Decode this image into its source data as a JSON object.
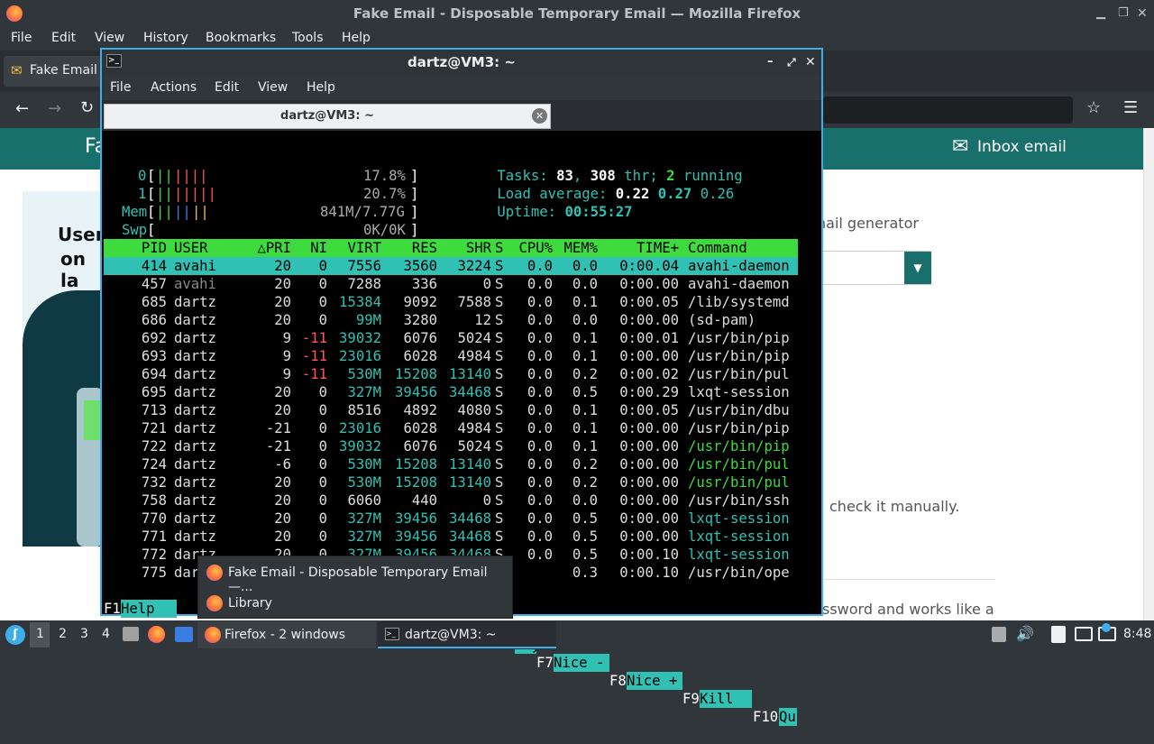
{
  "firefox": {
    "title": "Fake Email - Disposable Temporary Email — Mozilla Firefox",
    "menu": [
      "File",
      "Edit",
      "View",
      "History",
      "Bookmarks",
      "Tools",
      "Help"
    ],
    "tab_label": "Fake Email",
    "page": {
      "inbox_label": "Inbox email",
      "promo_title_1": "User",
      "promo_title_2": "on la",
      "header_left_fragment": "Fa",
      "generator_text": "nail generator",
      "check_text": "check it manually.",
      "password_text": "ssword and works like a"
    }
  },
  "terminal": {
    "title": "dartz@VM3: ~",
    "menu": [
      "File",
      "Actions",
      "Edit",
      "View",
      "Help"
    ],
    "tab_label": "dartz@VM3: ~",
    "htop": {
      "cpu0_label": "0",
      "cpu0_pct": "17.8%",
      "cpu1_label": "1",
      "cpu1_pct": "20.7%",
      "mem_label": "Mem",
      "mem_value": "841M/7.77G",
      "swp_label": "Swp",
      "swp_value": "0K/0K",
      "tasks_label": "Tasks:",
      "tasks_count": "83",
      "thr_count": "308",
      "thr_label": "thr;",
      "running_count": "2",
      "running_label": "running",
      "load_label": "Load average:",
      "load1": "0.22",
      "load5": "0.27",
      "load15": "0.26",
      "uptime_label": "Uptime:",
      "uptime": "00:55:27",
      "columns": [
        "PID",
        "USER",
        "△PRI",
        "NI",
        "VIRT",
        "RES",
        "SHR",
        "S",
        "CPU%",
        "MEM%",
        "TIME+",
        "Command"
      ],
      "rows": [
        [
          "414",
          "avahi",
          "20",
          "0",
          "7556",
          "3560",
          "3224",
          "S",
          "0.0",
          "0.0",
          "0:00.04",
          "avahi-daemon"
        ],
        [
          "457",
          "avahi",
          "20",
          "0",
          "7288",
          "336",
          "0",
          "S",
          "0.0",
          "0.0",
          "0:00.00",
          "avahi-daemon"
        ],
        [
          "685",
          "dartz",
          "20",
          "0",
          "15384",
          "9092",
          "7588",
          "S",
          "0.0",
          "0.1",
          "0:00.05",
          "/lib/systemd"
        ],
        [
          "686",
          "dartz",
          "20",
          "0",
          "99M",
          "3280",
          "12",
          "S",
          "0.0",
          "0.0",
          "0:00.00",
          "(sd-pam)"
        ],
        [
          "692",
          "dartz",
          "9",
          "-11",
          "39032",
          "6076",
          "5024",
          "S",
          "0.0",
          "0.1",
          "0:00.01",
          "/usr/bin/pip"
        ],
        [
          "693",
          "dartz",
          "9",
          "-11",
          "23016",
          "6028",
          "4984",
          "S",
          "0.0",
          "0.1",
          "0:00.00",
          "/usr/bin/pip"
        ],
        [
          "694",
          "dartz",
          "9",
          "-11",
          "530M",
          "15208",
          "13140",
          "S",
          "0.0",
          "0.2",
          "0:00.02",
          "/usr/bin/pul"
        ],
        [
          "695",
          "dartz",
          "20",
          "0",
          "327M",
          "39456",
          "34468",
          "S",
          "0.0",
          "0.5",
          "0:00.29",
          "lxqt-session"
        ],
        [
          "713",
          "dartz",
          "20",
          "0",
          "8516",
          "4892",
          "4080",
          "S",
          "0.0",
          "0.1",
          "0:00.05",
          "/usr/bin/dbu"
        ],
        [
          "721",
          "dartz",
          "-21",
          "0",
          "23016",
          "6028",
          "4984",
          "S",
          "0.0",
          "0.1",
          "0:00.00",
          "/usr/bin/pip"
        ],
        [
          "722",
          "dartz",
          "-21",
          "0",
          "39032",
          "6076",
          "5024",
          "S",
          "0.0",
          "0.1",
          "0:00.00",
          "/usr/bin/pip"
        ],
        [
          "724",
          "dartz",
          "-6",
          "0",
          "530M",
          "15208",
          "13140",
          "S",
          "0.0",
          "0.2",
          "0:00.00",
          "/usr/bin/pul"
        ],
        [
          "732",
          "dartz",
          "20",
          "0",
          "530M",
          "15208",
          "13140",
          "S",
          "0.0",
          "0.2",
          "0:00.00",
          "/usr/bin/pul"
        ],
        [
          "758",
          "dartz",
          "20",
          "0",
          "6060",
          "440",
          "0",
          "S",
          "0.0",
          "0.0",
          "0:00.00",
          "/usr/bin/ssh"
        ],
        [
          "770",
          "dartz",
          "20",
          "0",
          "327M",
          "39456",
          "34468",
          "S",
          "0.0",
          "0.5",
          "0:00.00",
          "lxqt-session"
        ],
        [
          "771",
          "dartz",
          "20",
          "0",
          "327M",
          "39456",
          "34468",
          "S",
          "0.0",
          "0.5",
          "0:00.00",
          "lxqt-session"
        ],
        [
          "772",
          "dartz",
          "20",
          "0",
          "327M",
          "39456",
          "34468",
          "S",
          "0.0",
          "0.5",
          "0:00.10",
          "lxqt-session"
        ],
        [
          "775",
          "dar",
          "",
          "",
          "",
          "",
          "",
          "",
          "",
          "0.3",
          "0:00.10",
          "/usr/bin/ope"
        ]
      ],
      "fkeys": [
        {
          "key": "F1",
          "label": "Help"
        },
        {
          "key": "F2",
          "label": ""
        },
        {
          "key": "",
          "label": "tBy"
        },
        {
          "key": "F7",
          "label": "Nice -"
        },
        {
          "key": "F8",
          "label": "Nice +"
        },
        {
          "key": "F9",
          "label": "Kill"
        },
        {
          "key": "F10",
          "label": "Qu"
        }
      ]
    }
  },
  "popup": {
    "items": [
      "Fake Email - Disposable Temporary Email —...",
      "Library"
    ]
  },
  "taskbar": {
    "desktops": [
      "1",
      "2",
      "3",
      "4"
    ],
    "firefox_task": "Firefox - 2 windows",
    "terminal_task": "dartz@VM3: ~",
    "clock": "8:48"
  },
  "colors": {
    "teal_header": "#186f6b",
    "htop_green": "#3ddb3d",
    "htop_cyan": "#31c0b4",
    "accent_blue": "#3daee9"
  }
}
